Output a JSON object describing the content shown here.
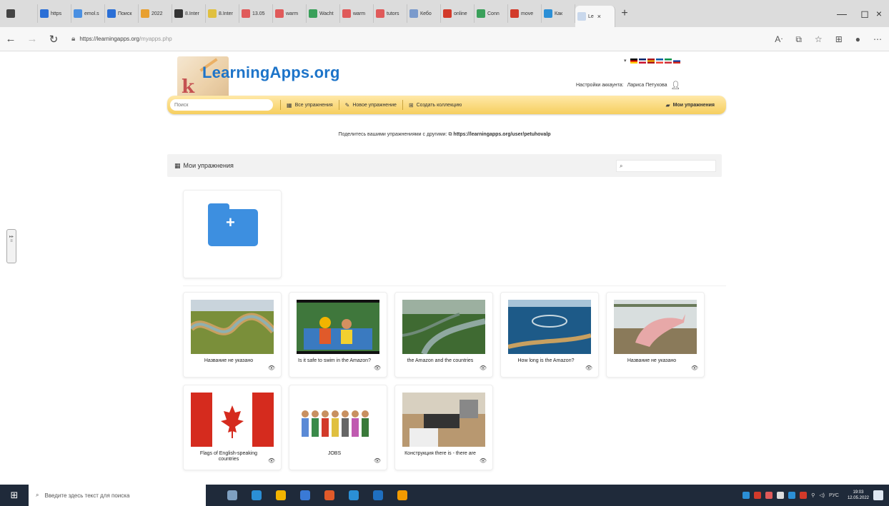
{
  "browser": {
    "tabs": [
      {
        "label": "",
        "color": "#444444"
      },
      {
        "label": "https",
        "color": "#2b6fd6"
      },
      {
        "label": "emol.s",
        "color": "#4a90e2"
      },
      {
        "label": "Поиск",
        "color": "#2b6fd6"
      },
      {
        "label": "2022",
        "color": "#e8a030"
      },
      {
        "label": "8.Inter",
        "color": "#333333"
      },
      {
        "label": "8.Inter",
        "color": "#e0c040"
      },
      {
        "label": "13.05",
        "color": "#e05a5a"
      },
      {
        "label": "warm",
        "color": "#e05a5a"
      },
      {
        "label": "Wacht",
        "color": "#3aa05a"
      },
      {
        "label": "warm",
        "color": "#e05a5a"
      },
      {
        "label": "tutors",
        "color": "#e05a5a"
      },
      {
        "label": "Кебо",
        "color": "#7a9acc"
      },
      {
        "label": "online",
        "color": "#d23a2a"
      },
      {
        "label": "Conn",
        "color": "#3aa05a"
      },
      {
        "label": "move",
        "color": "#d23a2a"
      },
      {
        "label": "Как",
        "color": "#2b8fd6"
      }
    ],
    "active_tab": {
      "label": "Le",
      "close": "×"
    },
    "new_tab": "+",
    "url_host": "https://learningapps.org",
    "url_path": "/myapps.php",
    "window": {
      "minimize": "—",
      "maximize": "◻",
      "close": "×"
    }
  },
  "header": {
    "logo_text": "LearningApps.org",
    "logo_mark": "k",
    "account_label": "Настройки аккаунта:",
    "account_name": "Лариса Петухова",
    "flags_arrow": "▾",
    "flag_colors": [
      [
        "#000000",
        "#dd0000",
        "#ffce00"
      ],
      [
        "#012169",
        "#ffffff",
        "#c8102e"
      ],
      [
        "#aa151b",
        "#f1bf00",
        "#aa151b"
      ],
      [
        "#0055a4",
        "#ffffff",
        "#ef4135"
      ],
      [
        "#009246",
        "#ffffff",
        "#ce2b37"
      ],
      [
        "#ffffff",
        "#0039a6",
        "#d52b1e"
      ]
    ]
  },
  "nav": {
    "search_placeholder": "Поиск",
    "all_apps": "Все упражнения",
    "new_app": "Новое упражнение",
    "create_collection": "Создать коллекцию",
    "my_apps": "Мои упражнения"
  },
  "share": {
    "text": "Поделитесь вашими упражнениями с другими:",
    "url": "https://learningapps.org/user/petuhovalp"
  },
  "section": {
    "title": "Мои упражнения",
    "search_icon": "search-icon"
  },
  "apps": [
    {
      "title": "Название не указано",
      "theme": "river"
    },
    {
      "title": "Is it safe to swim in the Amazon?",
      "theme": "people"
    },
    {
      "title": "the Amazon and the countries",
      "theme": "jungle"
    },
    {
      "title": "How long is the Amazon?",
      "theme": "aerial"
    },
    {
      "title": "Название не указано",
      "theme": "dolphin"
    },
    {
      "title": "Flags of English-speaking countries",
      "theme": "canada"
    },
    {
      "title": "JOBS",
      "theme": "jobs"
    },
    {
      "title": "Конструкция there is - there are",
      "theme": "room"
    }
  ],
  "taskbar": {
    "search_placeholder": "Введите здесь текст для поиска",
    "lang": "РУС",
    "time": "19:03",
    "date": "12.05.2022",
    "app_colors": [
      "#7fa0c0",
      "#2b8fd6",
      "#f2b400",
      "#3a7ad6",
      "#e05a2a",
      "#2b8fd6",
      "#1f6fc0",
      "#f29a00"
    ]
  }
}
